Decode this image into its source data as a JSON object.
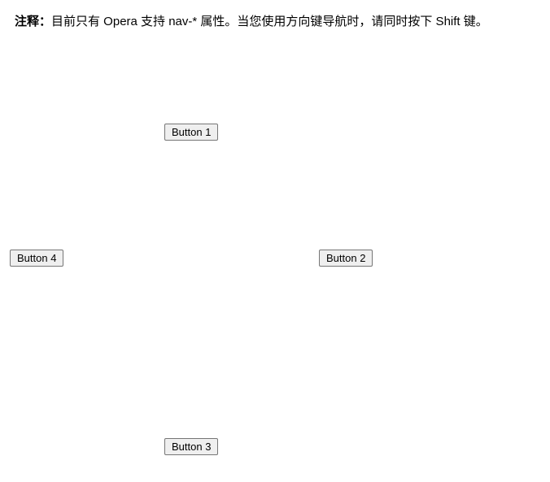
{
  "note": {
    "prefix": "注释：",
    "text": "目前只有 Opera 支持 nav-* 属性。当您使用方向键导航时，请同时按下 Shift 键。"
  },
  "buttons": {
    "b1": "Button 1",
    "b2": "Button 2",
    "b3": "Button 3",
    "b4": "Button 4"
  }
}
